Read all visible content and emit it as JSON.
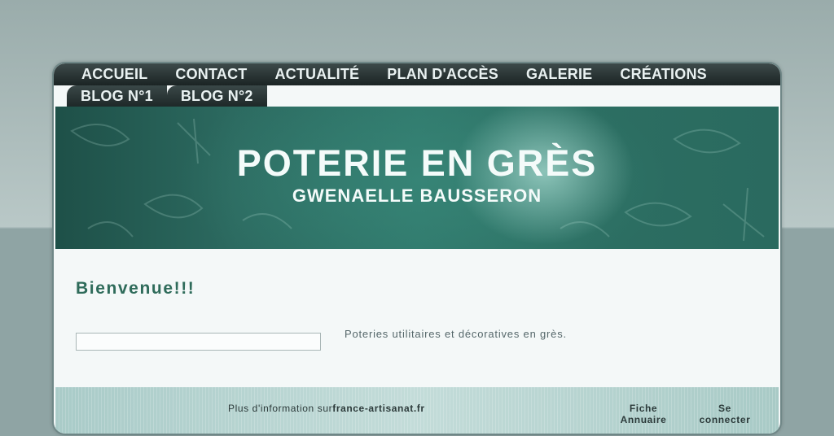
{
  "nav": {
    "row1": [
      "ACCUEIL",
      "CONTACT",
      "ACTUALITÉ",
      "PLAN D'ACCÈS",
      "GALERIE",
      "CRÉATIONS"
    ],
    "row2": [
      "BLOG N°1",
      "BLOG N°2"
    ]
  },
  "header": {
    "title": "POTERIE EN GRÈS",
    "subtitle": "GWENAELLE BAUSSERON"
  },
  "main": {
    "welcome": "Bienvenue!!!",
    "search_value": "",
    "description": "Poteries utilitaires et décoratives en grès."
  },
  "footer": {
    "info_prefix": "Plus d'information sur",
    "info_link": "france-artisanat.fr",
    "annuaire_line1": "Fiche",
    "annuaire_line2": "Annuaire",
    "connect_line1": "Se",
    "connect_line2": "connecter"
  },
  "colors": {
    "accent": "#2e6b5a",
    "banner": "#2c6e62",
    "nav_bg": "#1b2424"
  }
}
